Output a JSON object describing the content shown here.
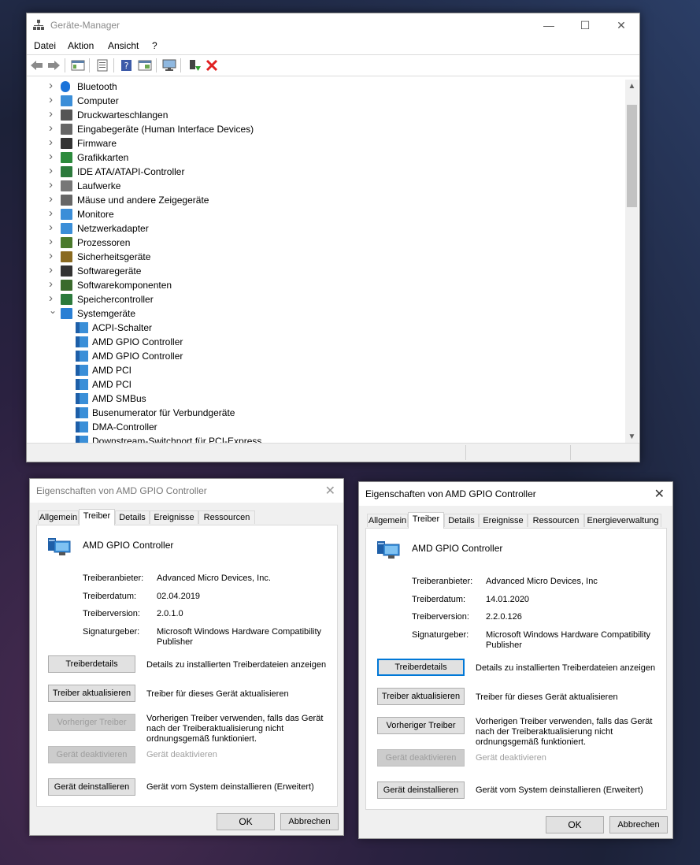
{
  "device_manager": {
    "title": "Geräte-Manager",
    "menu": [
      "Datei",
      "Aktion",
      "Ansicht",
      "?"
    ],
    "toolbar_icons": [
      "back-arrow-icon",
      "forward-arrow-icon",
      "show-hide-tree-icon",
      "properties-icon",
      "help-icon",
      "view-icon",
      "monitor-scan-icon",
      "enable-device-icon",
      "uninstall-x-icon"
    ],
    "categories": [
      {
        "label": "Bluetooth",
        "icon": "bluetooth-icon"
      },
      {
        "label": "Computer",
        "icon": "computer-icon"
      },
      {
        "label": "Druckwarteschlangen",
        "icon": "printer-icon"
      },
      {
        "label": "Eingabegeräte (Human Interface Devices)",
        "icon": "hid-icon"
      },
      {
        "label": "Firmware",
        "icon": "firmware-icon"
      },
      {
        "label": "Grafikkarten",
        "icon": "display-adapter-icon"
      },
      {
        "label": "IDE ATA/ATAPI-Controller",
        "icon": "ide-controller-icon"
      },
      {
        "label": "Laufwerke",
        "icon": "disk-drive-icon"
      },
      {
        "label": "Mäuse und andere Zeigegeräte",
        "icon": "mouse-icon"
      },
      {
        "label": "Monitore",
        "icon": "monitor-icon"
      },
      {
        "label": "Netzwerkadapter",
        "icon": "network-adapter-icon"
      },
      {
        "label": "Prozessoren",
        "icon": "processor-icon"
      },
      {
        "label": "Sicherheitsgeräte",
        "icon": "security-device-icon"
      },
      {
        "label": "Softwaregeräte",
        "icon": "software-device-icon"
      },
      {
        "label": "Softwarekomponenten",
        "icon": "software-component-icon"
      },
      {
        "label": "Speichercontroller",
        "icon": "storage-controller-icon"
      },
      {
        "label": "Systemgeräte",
        "icon": "system-device-icon"
      }
    ],
    "system_devices": [
      "ACPI-Schalter",
      "AMD GPIO Controller",
      "AMD GPIO Controller",
      "AMD PCI",
      "AMD PCI",
      "AMD SMBus",
      "Busenumerator für Verbundgeräte",
      "DMA-Controller",
      "Downstream-Switchport für PCI-Express"
    ]
  },
  "dialog_left": {
    "title": "Eigenschaften von AMD GPIO Controller",
    "tabs": [
      "Allgemein",
      "Treiber",
      "Details",
      "Ereignisse",
      "Ressourcen"
    ],
    "selected_tab": "Treiber",
    "device_name": "AMD GPIO Controller",
    "fields": [
      {
        "label": "Treiberanbieter:",
        "value": "Advanced Micro Devices, Inc."
      },
      {
        "label": "Treiberdatum:",
        "value": "02.04.2019"
      },
      {
        "label": "Treiberversion:",
        "value": "2.0.1.0"
      },
      {
        "label": "Signaturgeber:",
        "value": "Microsoft Windows Hardware Compatibility Publisher"
      }
    ],
    "actions": [
      {
        "button": "Treiberdetails",
        "desc": "Details zu installierten Treiberdateien anzeigen",
        "enabled": true
      },
      {
        "button": "Treiber aktualisieren",
        "desc": "Treiber für dieses Gerät aktualisieren",
        "enabled": true
      },
      {
        "button": "Vorheriger Treiber",
        "desc": "Vorherigen Treiber verwenden, falls das Gerät nach der Treiberaktualisierung nicht ordnungsgemäß funktioniert.",
        "enabled": false
      },
      {
        "button": "Gerät deaktivieren",
        "desc": "Gerät deaktivieren",
        "enabled": false
      },
      {
        "button": "Gerät deinstallieren",
        "desc": "Gerät vom System deinstallieren (Erweitert)",
        "enabled": true
      }
    ],
    "ok": "OK",
    "cancel": "Abbrechen"
  },
  "dialog_right": {
    "title": "Eigenschaften von AMD GPIO Controller",
    "tabs": [
      "Allgemein",
      "Treiber",
      "Details",
      "Ereignisse",
      "Ressourcen",
      "Energieverwaltung"
    ],
    "selected_tab": "Treiber",
    "device_name": "AMD GPIO Controller",
    "fields": [
      {
        "label": "Treiberanbieter:",
        "value": "Advanced Micro Devices, Inc"
      },
      {
        "label": "Treiberdatum:",
        "value": "14.01.2020"
      },
      {
        "label": "Treiberversion:",
        "value": "2.2.0.126"
      },
      {
        "label": "Signaturgeber:",
        "value": "Microsoft Windows Hardware Compatibility Publisher"
      }
    ],
    "actions": [
      {
        "button": "Treiberdetails",
        "desc": "Details zu installierten Treiberdateien anzeigen",
        "enabled": true
      },
      {
        "button": "Treiber aktualisieren",
        "desc": "Treiber für dieses Gerät aktualisieren",
        "enabled": true
      },
      {
        "button": "Vorheriger Treiber",
        "desc": "Vorherigen Treiber verwenden, falls das Gerät nach der Treiberaktualisierung nicht ordnungsgemäß funktioniert.",
        "enabled": true
      },
      {
        "button": "Gerät deaktivieren",
        "desc": "Gerät deaktivieren",
        "enabled": false
      },
      {
        "button": "Gerät deinstallieren",
        "desc": "Gerät vom System deinstallieren (Erweitert)",
        "enabled": true
      }
    ],
    "ok": "OK",
    "cancel": "Abbrechen"
  }
}
